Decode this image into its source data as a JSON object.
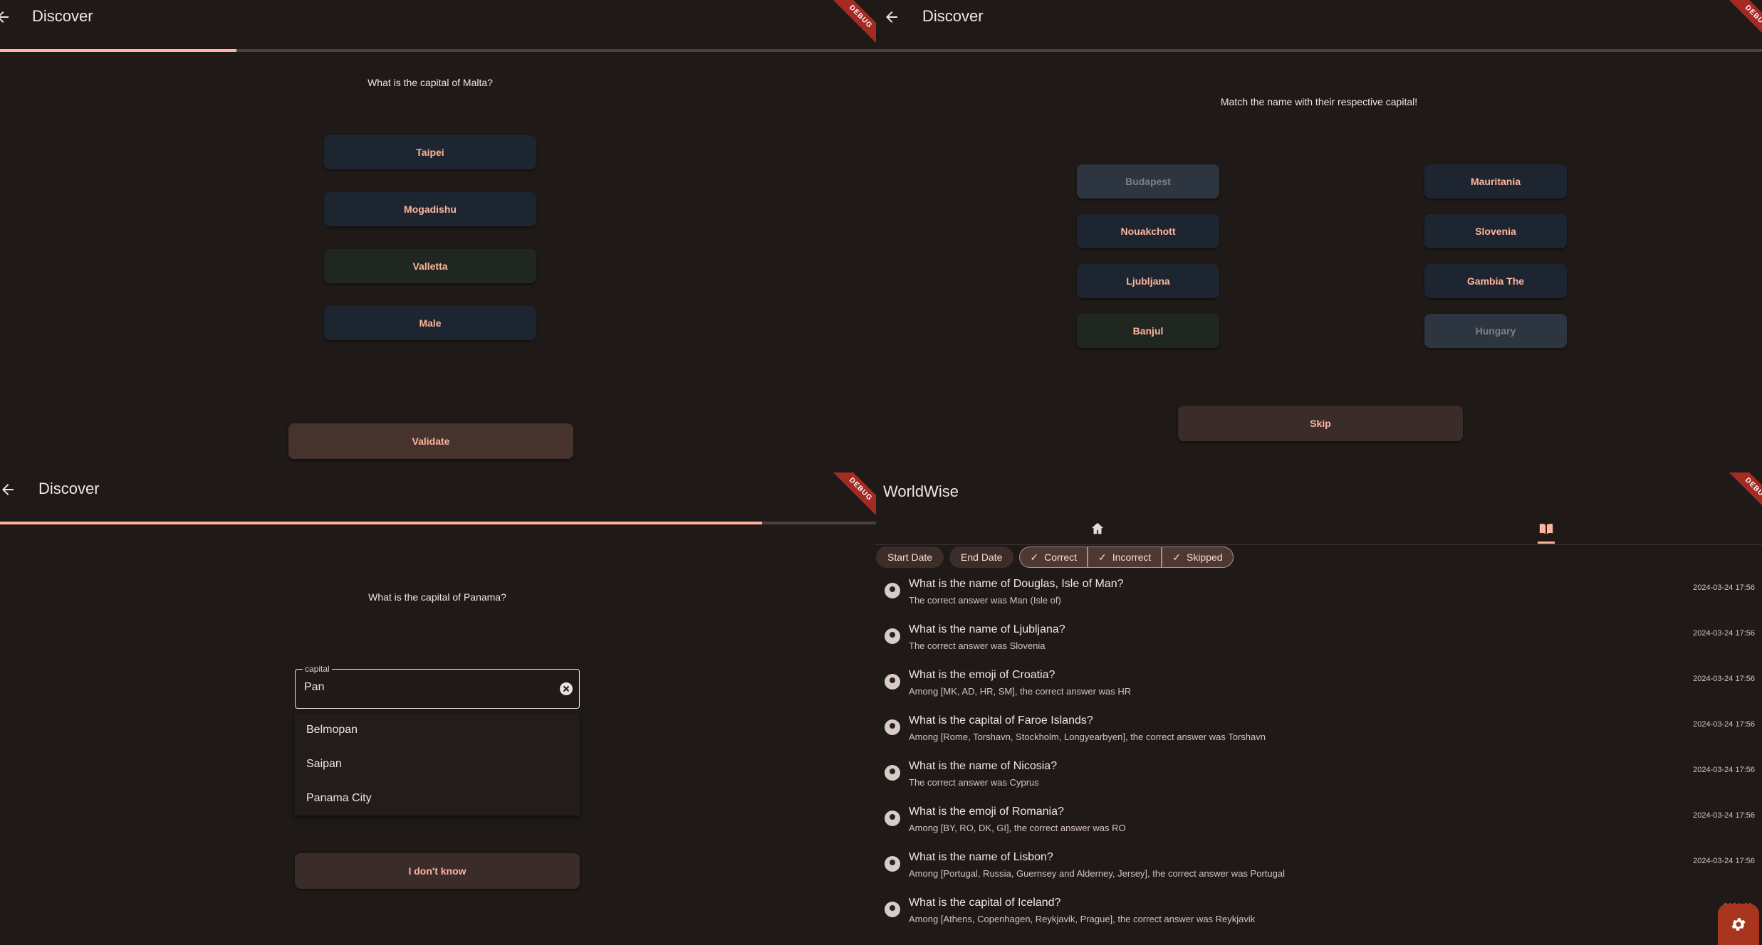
{
  "panel1": {
    "title": "Discover",
    "debug": "DEBUG",
    "progress": 0.27,
    "question": "What is the capital of Malta?",
    "options": [
      "Taipei",
      "Mogadishu",
      "Valletta",
      "Male"
    ],
    "validate_label": "Validate"
  },
  "panel2": {
    "title": "Discover",
    "debug": "DEBUG",
    "question": "Match the name with their respective capital!",
    "left": [
      "Budapest",
      "Nouakchott",
      "Ljubljana",
      "Banjul"
    ],
    "right": [
      "Mauritania",
      "Slovenia",
      "Gambia The",
      "Hungary"
    ],
    "skip_label": "Skip"
  },
  "panel3": {
    "title": "Discover",
    "debug": "DEBUG",
    "progress": 0.87,
    "question": "What is the capital of Panama?",
    "field_label": "capital",
    "field_value": "Pan",
    "suggestions": [
      "Belmopan",
      "Saipan",
      "Panama City"
    ],
    "dont_know_label": "I don't know"
  },
  "panel4": {
    "title": "WorldWise",
    "debug": "DEBUG",
    "icons": {
      "home": "home-icon",
      "history": "book-icon",
      "settings": "gear-icon"
    },
    "chips": {
      "start_date": "Start Date",
      "end_date": "End Date",
      "correct": "Correct",
      "incorrect": "Incorrect",
      "skipped": "Skipped"
    },
    "history": [
      {
        "q": "What is the name of Douglas, Isle of Man?",
        "a": "The correct answer was Man (Isle of)",
        "date": "2024-03-24 17:56"
      },
      {
        "q": "What is the name of Ljubljana?",
        "a": "The correct answer was Slovenia",
        "date": "2024-03-24 17:56"
      },
      {
        "q": "What is the emoji of Croatia?",
        "a": "Among [MK, AD, HR, SM], the correct answer was HR",
        "date": "2024-03-24 17:56"
      },
      {
        "q": "What is the capital of Faroe Islands?",
        "a": "Among [Rome, Torshavn, Stockholm, Longyearbyen], the correct answer was Torshavn",
        "date": "2024-03-24 17:56"
      },
      {
        "q": "What is the name of Nicosia?",
        "a": "The correct answer was Cyprus",
        "date": "2024-03-24 17:56"
      },
      {
        "q": "What is the emoji of Romania?",
        "a": "Among [BY, RO, DK, GI], the correct answer was RO",
        "date": "2024-03-24 17:56"
      },
      {
        "q": "What is the name of Lisbon?",
        "a": "Among [Portugal, Russia, Guernsey and Alderney, Jersey], the correct answer was Portugal",
        "date": "2024-03-24 17:56"
      },
      {
        "q": "What is the capital of Iceland?",
        "a": "Among [Athens, Copenhagen, Reykjavik, Prague], the correct answer was Reykjavik",
        "date": "2024-03-"
      }
    ]
  }
}
